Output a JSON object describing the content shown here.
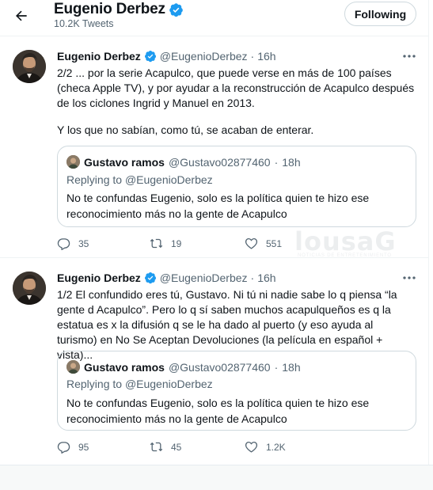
{
  "header": {
    "title": "Eugenio Derbez",
    "tweet_count": "10.2K Tweets",
    "follow_label": "Following"
  },
  "colors": {
    "verified": "#1d9bf0",
    "text_primary": "#0f1419",
    "text_secondary": "#536471",
    "border": "#cfd9de"
  },
  "icons": {
    "back": "arrow-left-icon",
    "verified": "verified-badge-icon",
    "more": "more-horizontal-icon",
    "reply": "reply-icon",
    "retweet": "retweet-icon",
    "like": "heart-icon"
  },
  "tweets": [
    {
      "name": "Eugenio Derbez",
      "handle": "@EugenioDerbez",
      "dot": "·",
      "time": "16h",
      "text_p1": "2/2 ... por la serie Acapulco, que puede verse en más de 100 países (checa Apple TV), y por ayudar a la reconstrucción de Acapulco después de los ciclones Ingrid y Manuel en 2013.",
      "text_p2": "Y los que no sabían, como tú, se acaban de enterar.",
      "quote": {
        "name": "Gustavo ramos",
        "handle": "@Gustavo02877460",
        "dot": "·",
        "time": "18h",
        "replying_prefix": "Replying to",
        "replying_to": "@EugenioDerbez",
        "text": "No te confundas Eugenio, solo es la política quien te hizo ese reconocimiento más no la gente de Acapulco"
      },
      "replies": "35",
      "retweets": "19",
      "likes": "551"
    },
    {
      "name": "Eugenio Derbez",
      "handle": "@EugenioDerbez",
      "dot": "·",
      "time": "16h",
      "text_p1": "1/2 El confundido eres tú, Gustavo. Ni tú ni nadie sabe lo q piensa “la gente d Acapulco”. Pero lo q sí saben muchos acapulqueños es q la estatua es x la difusión q se le ha dado al puerto (y eso ayuda al turismo) en No Se Aceptan Devoluciones (la película en español + vista)...",
      "quote": {
        "name": "Gustavo ramos",
        "handle": "@Gustavo02877460",
        "dot": "·",
        "time": "18h",
        "replying_prefix": "Replying to",
        "replying_to": "@EugenioDerbez",
        "text": "No te confundas Eugenio, solo es la política quien te hizo ese reconocimiento más no la gente de Acapulco"
      },
      "replies": "95",
      "retweets": "45",
      "likes": "1.2K"
    }
  ],
  "watermark": {
    "brand": "lousaG",
    "tagline": "NOTICIAS DE ENTRETENIMIENTO"
  }
}
